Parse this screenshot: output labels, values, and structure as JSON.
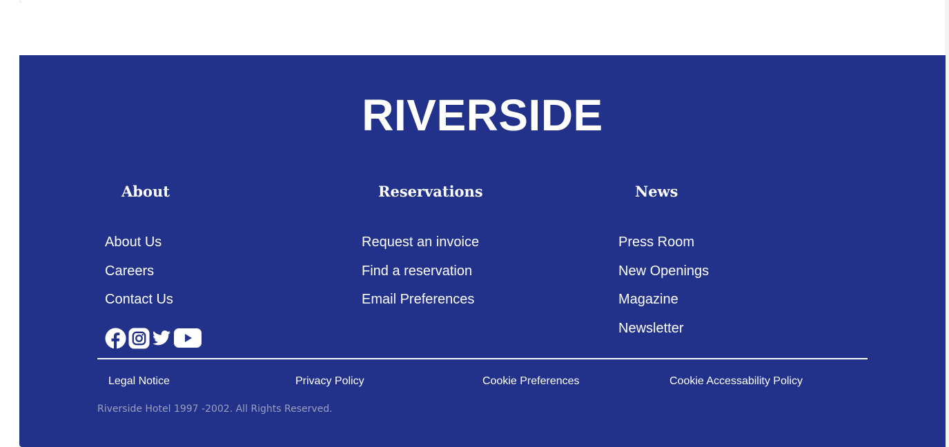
{
  "footer": {
    "brand": "RIVERSIDE",
    "background_color": "#22318a",
    "columns": [
      {
        "heading": "About",
        "links": [
          "About Us",
          "Careers",
          "Contact Us"
        ]
      },
      {
        "heading": "Reservations",
        "links": [
          "Request an invoice",
          "Find a reservation",
          "Email Preferences"
        ]
      },
      {
        "heading": "News",
        "links": [
          "Press Room",
          "New Openings",
          "Magazine",
          "Newsletter"
        ]
      }
    ],
    "social_icons": [
      "facebook-icon",
      "instagram-icon",
      "twitter-icon",
      "youtube-icon"
    ],
    "legal_links": [
      "Legal Notice",
      "Privacy Policy",
      "Cookie Preferences",
      "Cookie Accessability Policy"
    ],
    "copyright": "Riverside Hotel 1997 -2002. All Rights Reserved."
  }
}
